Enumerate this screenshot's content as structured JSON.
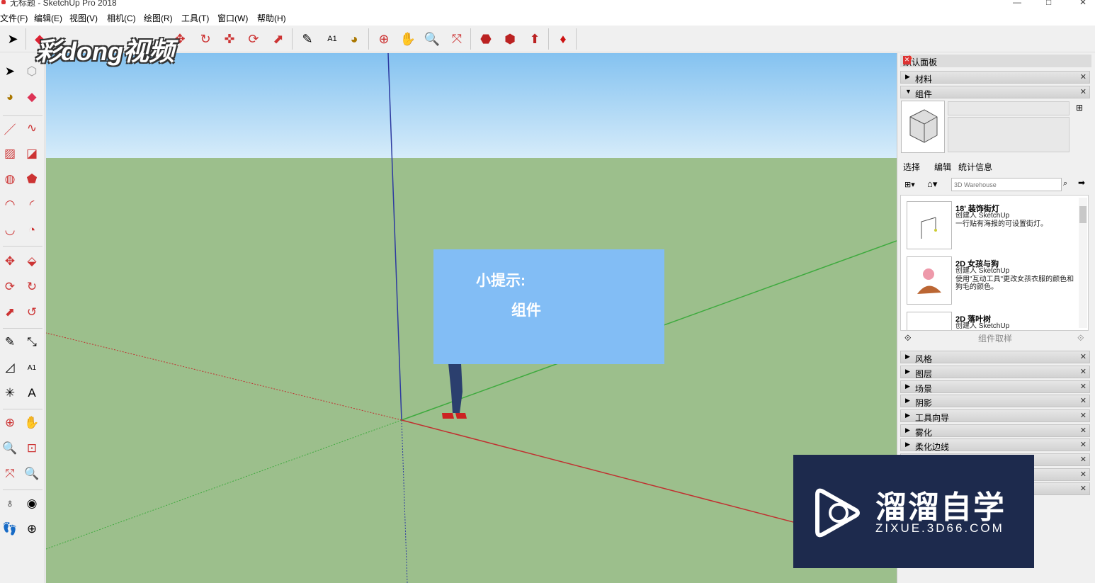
{
  "window": {
    "title": "无标题 - SketchUp Pro 2018",
    "min": "—",
    "max": "□",
    "close": "✕"
  },
  "menu": [
    "文件(F)",
    "编辑(E)",
    "视图(V)",
    "相机(C)",
    "绘图(R)",
    "工具(T)",
    "窗口(W)",
    "帮助(H)"
  ],
  "watermark_top_left": "彩dong视频",
  "hint": {
    "title": "小提示:",
    "body": "组件"
  },
  "panel": {
    "title": "默认面板",
    "sections_top": [
      "材料",
      "组件"
    ],
    "tabs": [
      "选择",
      "编辑",
      "统计信息"
    ],
    "search_placeholder": "3D Warehouse",
    "components": [
      {
        "name": "18' 装饰街灯",
        "author": "创建人 SketchUp",
        "desc": "一行贴有海报的可设置街灯。"
      },
      {
        "name": "2D 女孩与狗",
        "author": "创建人 SketchUp",
        "desc": "使用\"互动工具\"更改女孩衣服的颜色和狗毛的颜色。"
      },
      {
        "name": "2D 落叶树",
        "author": "创建人 SketchUp",
        "desc": ""
      }
    ],
    "sampler_label": "组件取样",
    "sections_bottom": [
      "风格",
      "图层",
      "场景",
      "阴影",
      "工具向导",
      "雾化",
      "柔化边线"
    ]
  },
  "watermark_bottom_right": {
    "brand": "溜溜自学",
    "url": "ZIXUE.3D66.COM"
  },
  "colors": {
    "sky": "#84c2f0",
    "ground": "#9cbf8c",
    "hint_bg": "#82bdf5",
    "brand_bg": "#1d2a4d"
  }
}
